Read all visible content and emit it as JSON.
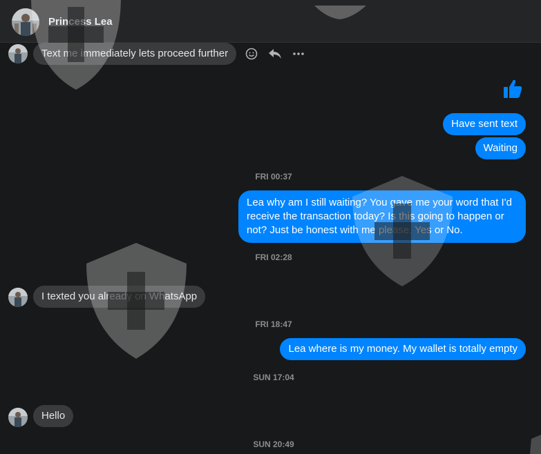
{
  "header": {
    "contact_name": "Princess Lea"
  },
  "icons": {
    "emoji": "smiley-icon",
    "reply": "reply-icon",
    "more": "more-options-icon",
    "like": "thumbs-up-icon",
    "watermark": "shield-cross-watermark"
  },
  "colors": {
    "outgoing": "#0084ff",
    "incoming": "#3a3b3c",
    "background": "#18191a",
    "timestamp": "#8a8d91"
  },
  "messages": {
    "m1": "Text me immediately lets proceed further",
    "m2": "Have sent text",
    "m3": "Waiting",
    "ts1": "FRI 00:37",
    "m4": "Lea why am I still waiting? You gave me your word that I'd receive the transaction today? Is this going to happen or not? Just be honest with me please. Yes or No.",
    "ts2": "FRI 02:28",
    "m5": "I texted you already on WhatsApp",
    "ts3": "FRI 18:47",
    "m6": "Lea where is my money. My wallet is totally empty",
    "ts4": "SUN 17:04",
    "m7": "Hello",
    "ts5": "SUN 20:49"
  }
}
